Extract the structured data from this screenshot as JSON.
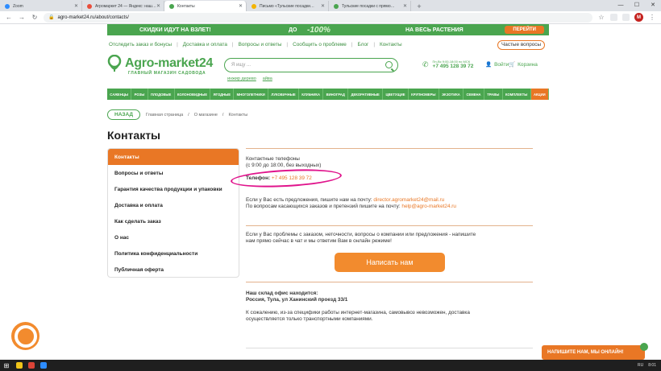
{
  "browser": {
    "tabs": [
      {
        "label": "Zoom",
        "color": "#2d8cff",
        "active": false
      },
      {
        "label": "Агромаркет 24 — Яндекс: нашл…",
        "color": "#e94e3c",
        "active": false
      },
      {
        "label": "Контакты",
        "color": "#4aa54f",
        "active": true
      },
      {
        "label": "Письмо «Тульские посадки…",
        "color": "#f4b400",
        "active": false
      },
      {
        "label": "Тульские посадки с прямо…",
        "color": "#4aa54f",
        "active": false
      }
    ],
    "url": "agro-market24.ru/about/contacts/",
    "profile_initial": "M"
  },
  "promo": {
    "left": "СКИДКИ ИДУТ НА ВЗЛЕТ!",
    "mid_prefix": "ДО",
    "mid_value": "-100%",
    "right": "НА ВЕСЬ РАСТЕНИЯ",
    "cta": "ПЕРЕЙТИ"
  },
  "toplinks": [
    "Отследить заказ и бонусы",
    "Доставка и оплата",
    "Вопросы и ответы",
    "Сообщить о проблеме",
    "Блог",
    "Контакты"
  ],
  "faq_button": "Частые вопросы",
  "logo": {
    "name": "Agro-market24",
    "tagline": "ГЛАВНЫЙ МАГАЗИН САДОВОДА"
  },
  "search": {
    "placeholder": "Я ищу ...",
    "hints": [
      "инжир дерево",
      "айва"
    ]
  },
  "header_phone": {
    "hours": "Пн-Вс 9:00-18:00 по МСК",
    "number": "+7 495 128 39 72"
  },
  "login_label": "Войти",
  "cart_label": "Корзина",
  "categories": [
    "САЖЕНЦЫ",
    "РОЗЫ",
    "ПЛОДОВЫЕ",
    "КОЛОНОВИДНЫЕ",
    "ЯГОДНЫЕ",
    "МНОГОЛЕТНИКИ",
    "ЛУКОВИЧНЫЕ",
    "КЛУБНИКА",
    "ВИНОГРАД",
    "ДЕКОРАТИВНЫЕ",
    "ЦВЕТУЩИЕ",
    "КРУПНОМЕРЫ",
    "ЭКЗОТИКА",
    "СЕМЕНА",
    "ТРАВЫ",
    "КОМПЛЕКТЫ",
    "АКЦИИ"
  ],
  "back_label": "НАЗАД",
  "breadcrumbs": [
    "Главная страница",
    "/",
    "О магазине",
    "/",
    "Контакты"
  ],
  "page_title": "Контакты",
  "sidebar": [
    "Контакты",
    "Вопросы и ответы",
    "Гарантия качества продукции и упаковки",
    "Доставка и оплата",
    "Как сделать заказ",
    "О нас",
    "Политика конфиденциальности",
    "Публичная оферта"
  ],
  "content": {
    "phones_title": "Контактные телефоны",
    "phones_hours": "(с 9:00 до 18:00, без выходных)",
    "phone_label": "Телефон:",
    "phone_value": "+7 495 128 39 72",
    "email_line1_prefix": "Если у Вас есть предложения, пишите нам на почту:",
    "email1": "director.agromarket24@mail.ru",
    "email_line2_prefix": "По вопросам касающихся заказов и претензий пишите на почту:",
    "email2": "help@agro-market24.ru",
    "chat_text_1": "Если у Вас проблемы с заказом, неточности, вопросы о компании или предложения - напишите",
    "chat_text_2": "нам прямо сейчас в чат и мы ответим Вам в онлайн режиме!",
    "write_button": "Написать нам",
    "office_title": "Наш склад офис находится:",
    "office_address": "Россия, Тула, ул Ханинский проезд 33/1",
    "pickup_1": "К сожалению, из-за специфики работы интернет-магазина, самовывоз невозможен, доставка",
    "pickup_2": "осуществляется только транспортными компаниями."
  },
  "chat_widget": "НАПИШИТЕ НАМ, МЫ ОНЛАЙН!",
  "taskbar": {
    "lang": "RU",
    "time": "8:01"
  }
}
